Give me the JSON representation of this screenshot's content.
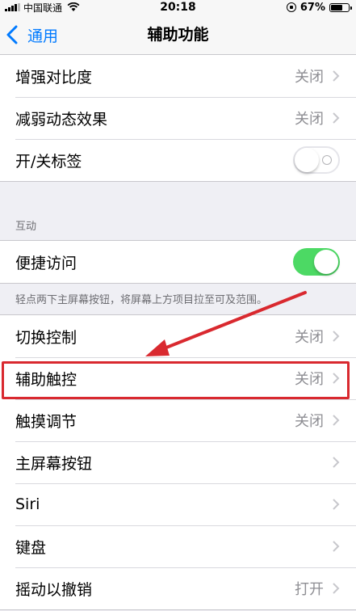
{
  "status_bar": {
    "carrier": "中国联通",
    "time": "20:18",
    "battery_percent": "67%",
    "battery_level": 0.67
  },
  "nav": {
    "back_label": "通用",
    "title": "辅助功能"
  },
  "group_top": [
    {
      "label": "增强对比度",
      "value": "关闭"
    },
    {
      "label": "减弱动态效果",
      "value": "关闭"
    },
    {
      "label": "开/关标签",
      "switch": "off"
    }
  ],
  "section_interaction": {
    "header": "互动",
    "reachability": {
      "label": "便捷访问",
      "switch": "on"
    },
    "footer": "轻点两下主屏幕按钮，将屏幕上方项目拉至可及范围。"
  },
  "group_bottom": [
    {
      "label": "切换控制",
      "value": "关闭"
    },
    {
      "label": "辅助触控",
      "value": "关闭"
    },
    {
      "label": "触摸调节",
      "value": "关闭"
    },
    {
      "label": "主屏幕按钮",
      "value": ""
    },
    {
      "label": "Siri",
      "value": ""
    },
    {
      "label": "键盘",
      "value": ""
    },
    {
      "label": "摇动以撤销",
      "value": "打开"
    }
  ],
  "colors": {
    "accent": "#007aff",
    "switch_on": "#4cd964",
    "annotation_red": "#d9292f",
    "background": "#efeff4"
  },
  "icons": [
    "signal-bars-icon",
    "wifi-icon",
    "rotation-lock-icon",
    "battery-icon",
    "back-chevron-icon",
    "disclosure-chevron-icon"
  ]
}
